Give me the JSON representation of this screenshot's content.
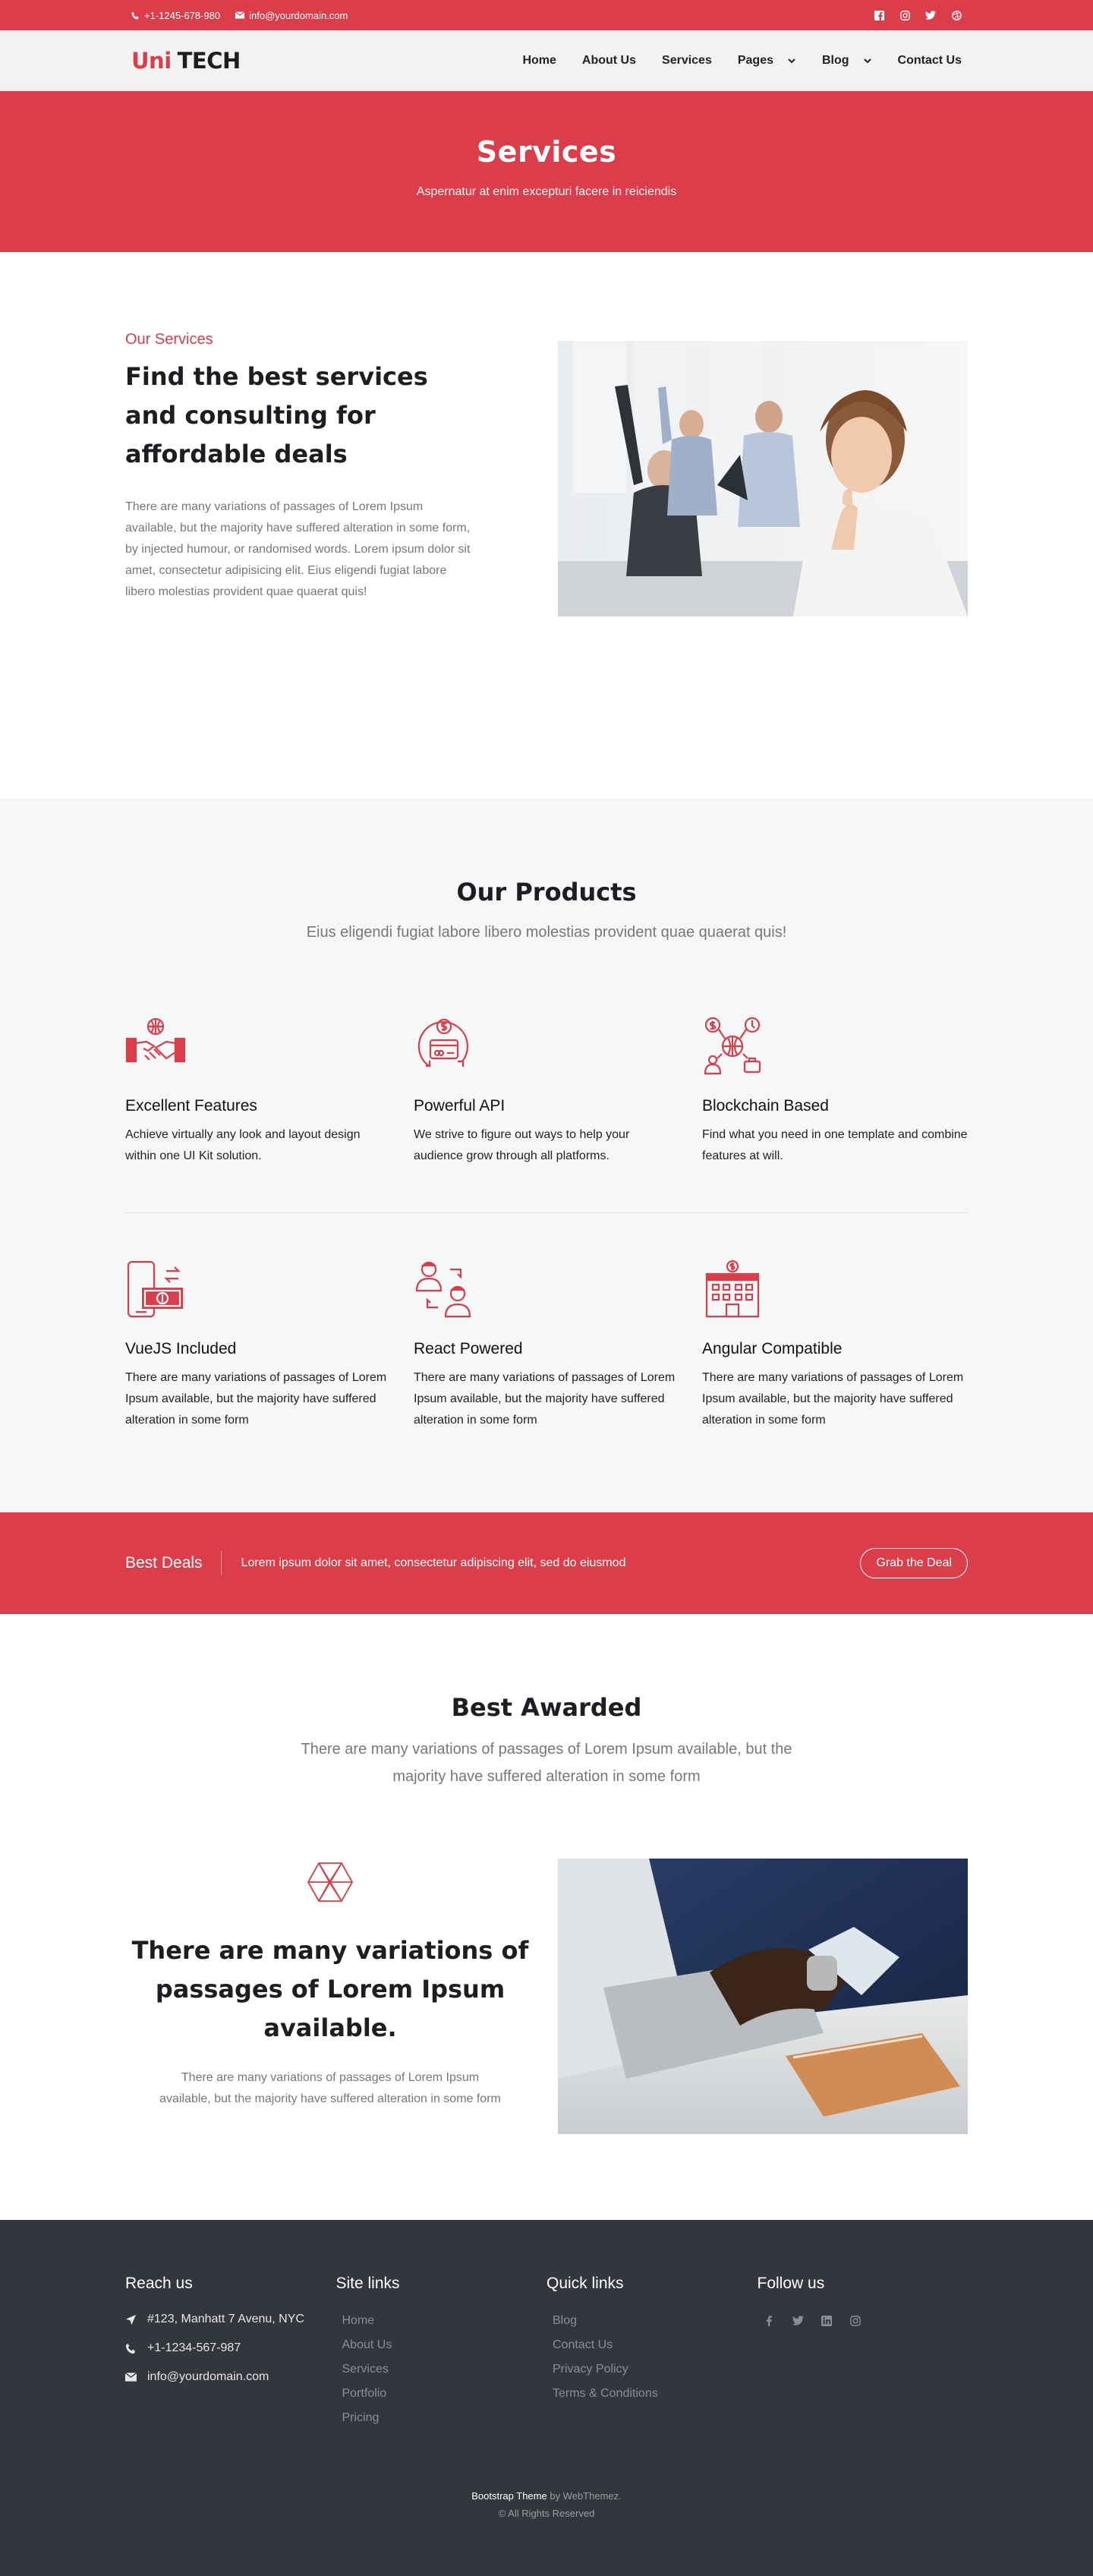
{
  "topbar": {
    "phone": "+1-1245-678-980",
    "email": "info@yourdomain.com",
    "social_icons": [
      "facebook-icon",
      "instagram-icon",
      "twitter-icon",
      "dribbble-icon"
    ]
  },
  "brand": {
    "part1": "Uni",
    "part2": "TECH"
  },
  "nav": {
    "home": "Home",
    "about": "About Us",
    "services": "Services",
    "pages": "Pages",
    "blog": "Blog",
    "contact": "Contact Us"
  },
  "page_header": {
    "title": "Services",
    "subtitle": "Aspernatur at enim excepturi facere in reiciendis"
  },
  "intro": {
    "eyebrow": "Our Services",
    "heading": "Find the best services and consulting for affordable deals",
    "body": "There are many variations of passages of Lorem Ipsum available, but the majority have suffered alteration in some form, by injected humour, or randomised words. Lorem ipsum dolor sit amet, consectetur adipisicing elit. Eius eligendi fugiat labore libero molestias provident quae quaerat quis!"
  },
  "products": {
    "title": "Our Products",
    "subtitle": "Eius eligendi fugiat labore libero molestias provident quae quaerat quis!",
    "row1": [
      {
        "icon": "handshake-globe-icon",
        "title": "Excellent Features",
        "text": "Achieve virtually any look and layout design within one UI Kit solution."
      },
      {
        "icon": "dollar-exchange-card-icon",
        "title": "Powerful API",
        "text": "We strive to figure out ways to help your audience grow through all platforms."
      },
      {
        "icon": "network-people-icon",
        "title": "Blockchain Based",
        "text": "Find what you need in one template and combine features at will."
      }
    ],
    "row2": [
      {
        "icon": "mobile-payment-icon",
        "title": "VueJS Included",
        "text": "There are many variations of passages of Lorem Ipsum available, but the majority have suffered alteration in some form"
      },
      {
        "icon": "people-exchange-icon",
        "title": "React Powered",
        "text": "There are many variations of passages of Lorem Ipsum available, but the majority have suffered alteration in some form"
      },
      {
        "icon": "bank-building-icon",
        "title": "Angular Compatible",
        "text": "There are many variations of passages of Lorem Ipsum available, but the majority have suffered alteration in some form"
      }
    ]
  },
  "deal": {
    "title": "Best Deals",
    "text": "Lorem ipsum dolor sit amet, consectetur adipiscing elit, sed do eiusmod",
    "button": "Grab the Deal"
  },
  "awarded": {
    "title": "Best Awarded",
    "subtitle": "There are many variations of passages of Lorem Ipsum available, but the majority have suffered alteration in some form",
    "heading": "There are many variations of passages of Lorem Ipsum available.",
    "body": "There are many variations of passages of Lorem Ipsum available, but the majority have suffered alteration in some form"
  },
  "footer": {
    "reach": {
      "title": "Reach us",
      "address": "#123, Manhatt 7 Avenu, NYC",
      "phone": "+1-1234-567-987",
      "email": "info@yourdomain.com"
    },
    "site_links": {
      "title": "Site links",
      "items": [
        "Home",
        "About Us",
        "Services",
        "Portfolio",
        "Pricing"
      ]
    },
    "quick_links": {
      "title": "Quick links",
      "items": [
        "Blog",
        "Contact Us",
        "Privacy Policy",
        "Terms & Conditions"
      ]
    },
    "follow": {
      "title": "Follow us",
      "icons": [
        "facebook-icon",
        "twitter-icon",
        "linkedin-icon",
        "instagram-icon"
      ]
    },
    "credit_theme": "Bootstrap Theme",
    "credit_by": "by WebThemez.",
    "rights": "© All Rights Reserved"
  },
  "colors": {
    "accent": "#dc3d4a",
    "dark": "#1d1d22",
    "footer_bg": "#33363d",
    "section_bg": "#f6f7f9",
    "nav_bg": "#f2f2f2"
  }
}
